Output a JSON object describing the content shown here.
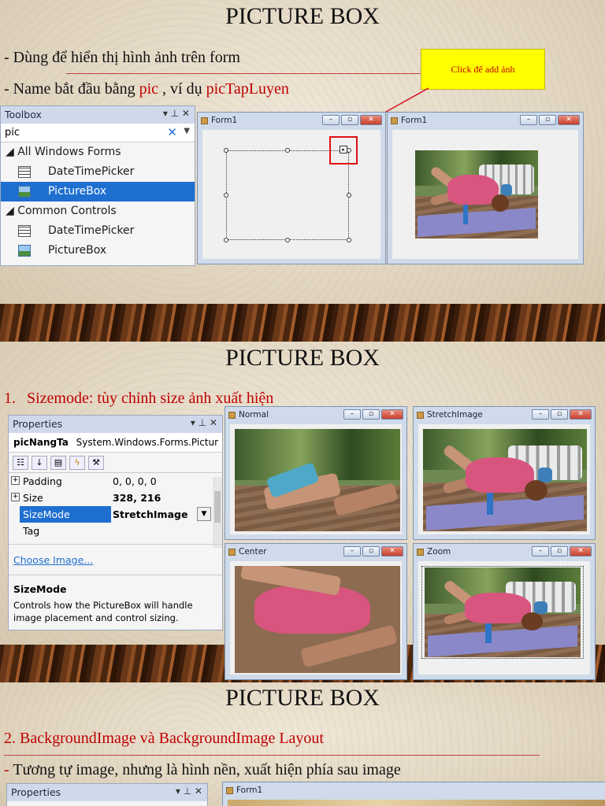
{
  "slide1": {
    "title": "PICTURE BOX",
    "line1": "- Dùng để hiển thị hình ảnh trên form",
    "line2_prefix": "- Name bắt đầu bằng ",
    "line2_red1": "pic",
    "line2_mid": " , ví dụ ",
    "line2_red2": "picTapLuyen",
    "callout": "Click để add ảnh",
    "toolbox": {
      "title": "Toolbox",
      "search_value": "pic",
      "clear_icon": "✕",
      "pin": "▾ ⊥ ✕",
      "categories": [
        {
          "label": "◢ All Windows Forms",
          "items": [
            "DateTimePicker",
            "PictureBox"
          ]
        },
        {
          "label": "◢ Common Controls",
          "items": [
            "DateTimePicker",
            "PictureBox"
          ]
        }
      ]
    },
    "form_left_title": "Form1",
    "form_right_title": "Form1"
  },
  "slide2": {
    "title": "PICTURE BOX",
    "heading_num": "1.",
    "heading": "Sizemode: tùy chỉnh size ảnh xuất hiện",
    "properties": {
      "title": "Properties",
      "pin": "▾ ⊥ ✕",
      "object": "picNangTa",
      "object_type": "System.Windows.Forms.Pictur",
      "rows": [
        {
          "name": "Padding",
          "value": "0, 0, 0, 0"
        },
        {
          "name": "Size",
          "value": "328, 216"
        },
        {
          "name": "SizeMode",
          "value": "StretchImage"
        },
        {
          "name": "Tag",
          "value": ""
        }
      ],
      "link": "Choose Image...",
      "desc_title": "SizeMode",
      "desc": "Controls how the PictureBox will handle image placement and control sizing."
    },
    "windows": [
      "Normal",
      "StretchImage",
      "Center",
      "Zoom"
    ]
  },
  "slide3": {
    "title": "PICTURE BOX",
    "heading": "2. BackgroundImage và BackgroundImage Layout",
    "line_dash": "- ",
    "line": "Tương tự image, nhưng là hình nền, xuất hiện phía sau image",
    "properties_title": "Properties",
    "pin": "▾ ⊥ ✕",
    "form_title": "Form1"
  }
}
